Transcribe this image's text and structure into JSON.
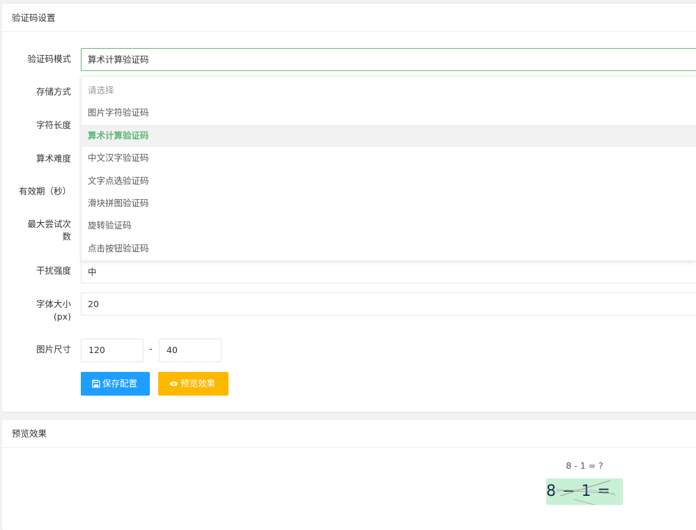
{
  "settings_card": {
    "title": "验证码设置",
    "labels": {
      "mode": "验证码模式",
      "storage": "存储方式",
      "length": "字符长度",
      "difficulty": "算术难度",
      "ttl": "有效期（秒）",
      "max_attempts_line1": "最大尝试次",
      "max_attempts_line2": "数",
      "noise": "干扰强度",
      "font_size_line1": "字体大小",
      "font_size_line2": "(px)",
      "image_size": "图片尺寸"
    },
    "mode_value": "算术计算验证码",
    "noise_value": "中",
    "font_size_value": "20",
    "image_width": "120",
    "image_separator": "-",
    "image_height": "40",
    "dropdown": {
      "options": [
        "请选择",
        "图片字符验证码",
        "算术计算验证码",
        "中文汉字验证码",
        "文字点选验证码",
        "滑块拼图验证码",
        "旋转验证码",
        "点击按钮验证码"
      ],
      "selected": "算术计算验证码"
    },
    "buttons": {
      "save": "保存配置",
      "preview": "预览效果"
    }
  },
  "preview_card": {
    "title": "预览效果",
    "formula": "8 - 1 = ?",
    "captcha_text": "8 − 1 =  ?"
  },
  "colors": {
    "accent_green": "#5fb878",
    "save_blue": "#1e9fff",
    "preview_orange": "#ffb800",
    "captcha_bg": "#c8f0d4"
  },
  "icons": {
    "save": "floppy-disk-icon",
    "preview": "eye-icon"
  }
}
